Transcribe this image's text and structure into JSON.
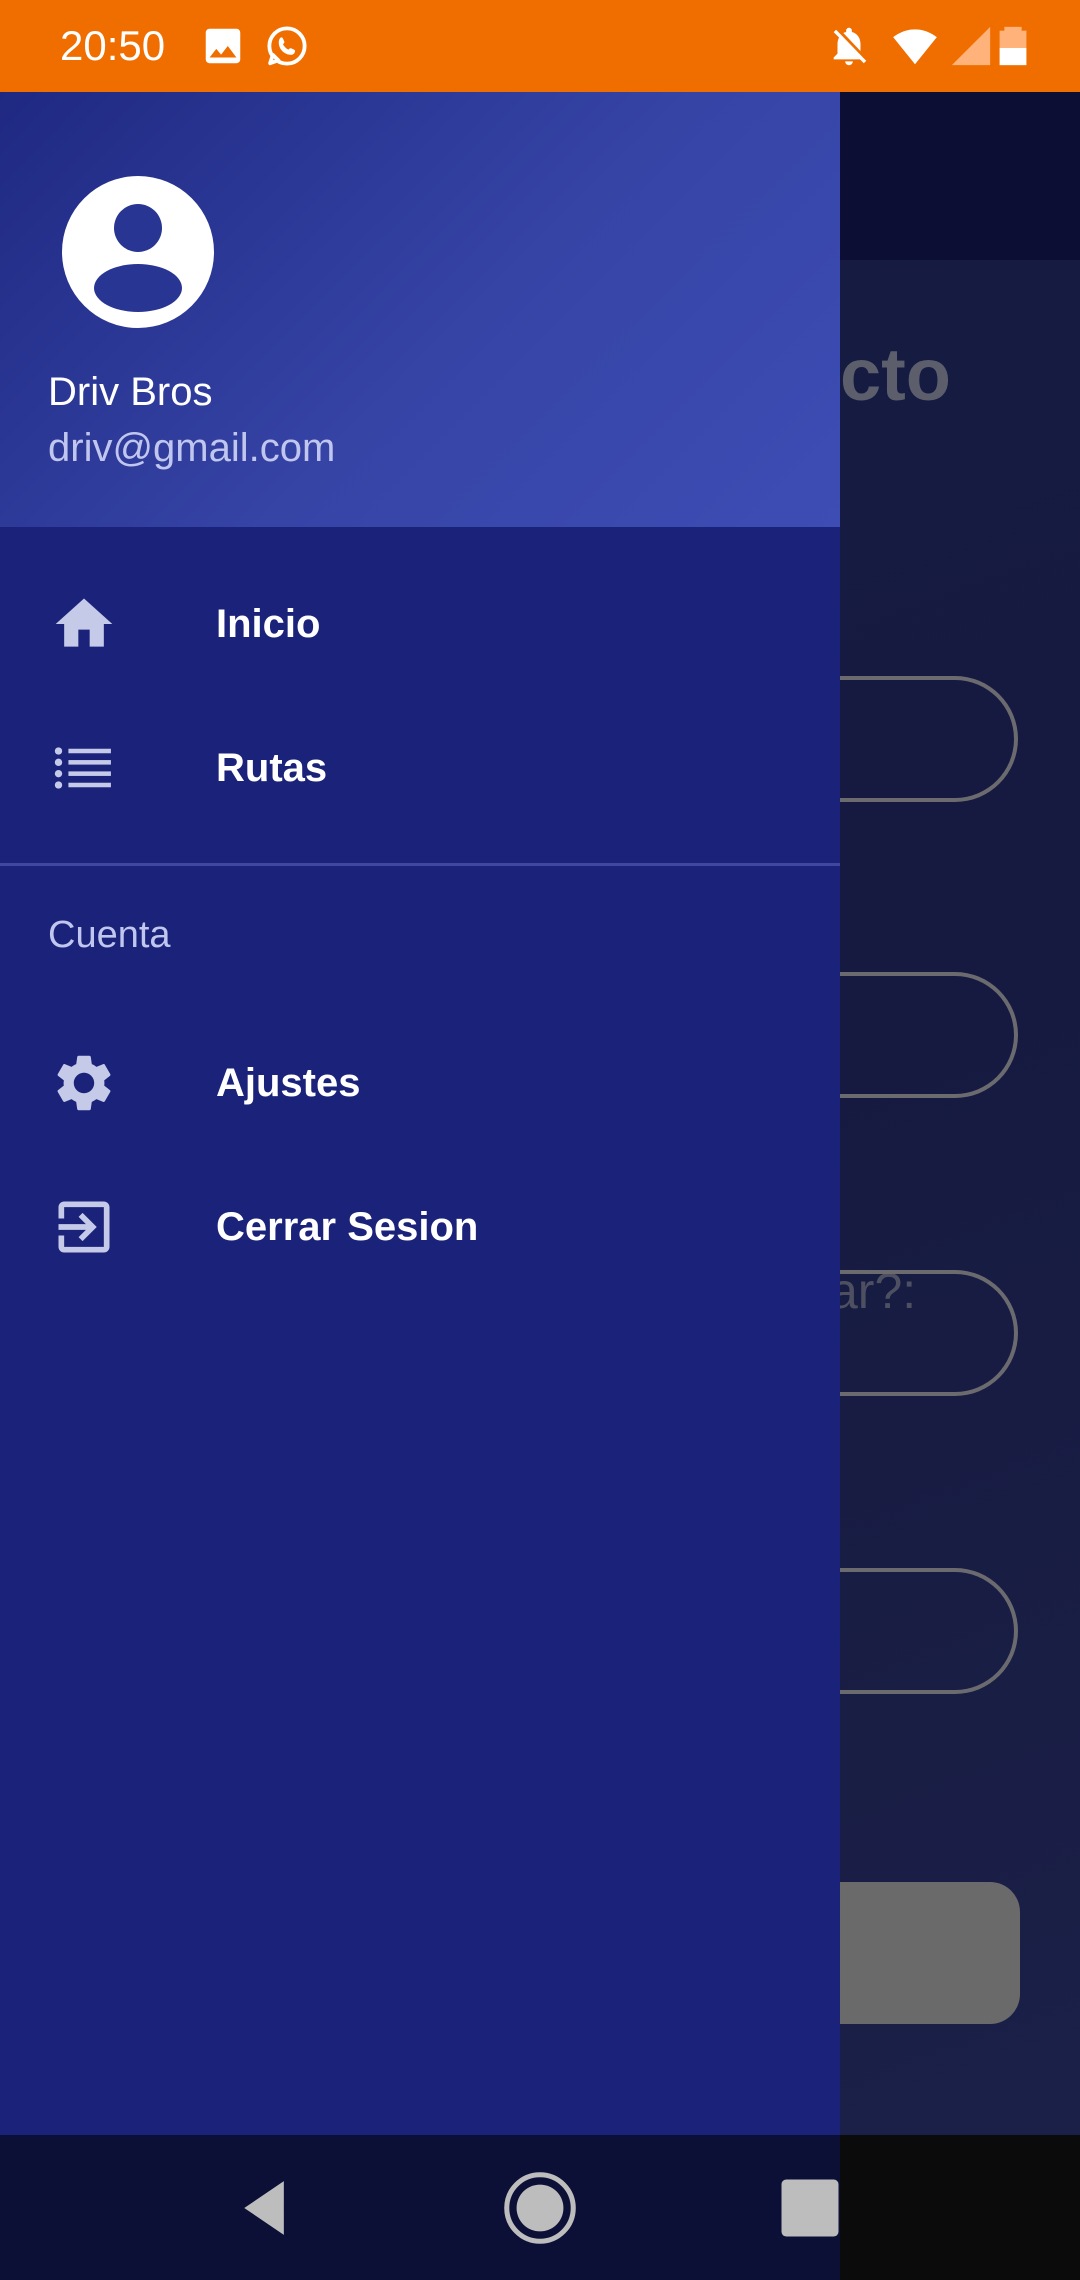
{
  "status_bar": {
    "time": "20:50",
    "icons": [
      "image-icon",
      "whatsapp-icon",
      "notifications-off-icon",
      "wifi-icon",
      "signal-icon",
      "battery-icon"
    ],
    "background": "#f06d00"
  },
  "drawer": {
    "header": {
      "user_name": "Driv Bros",
      "user_email": "driv@gmail.com"
    },
    "items": [
      {
        "label": "Inicio",
        "icon": "home-icon"
      },
      {
        "label": "Rutas",
        "icon": "list-icon"
      }
    ],
    "section_title": "Cuenta",
    "account_items": [
      {
        "label": "Ajustes",
        "icon": "settings-icon"
      },
      {
        "label": "Cerrar Sesion",
        "icon": "logout-icon"
      }
    ],
    "background": "#1a227a"
  },
  "background_app": {
    "title_fragment": "cto",
    "question_fragment": "ar?:"
  },
  "nav_bar": {
    "buttons": [
      "back-icon",
      "home-circle-icon",
      "recents-icon"
    ]
  }
}
